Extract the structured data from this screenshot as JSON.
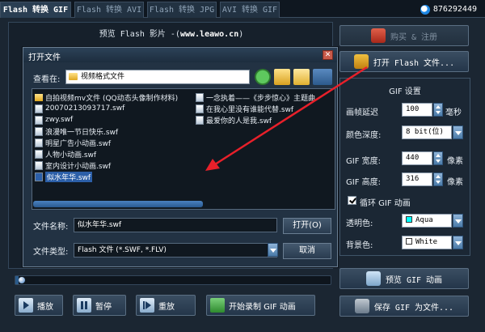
{
  "tabs": [
    {
      "label": "Flash 转换 GIF",
      "active": true
    },
    {
      "label": "Flash 转换 AVI",
      "active": false
    },
    {
      "label": "Flash 转换 JPG",
      "active": false
    },
    {
      "label": "AVI 转换 GIF",
      "active": false
    }
  ],
  "qq": "876292449",
  "preview": {
    "title_prefix": "预览 Flash 影片 -(",
    "site": "www.leawo.cn",
    "title_suffix": ")"
  },
  "right": {
    "buy_label": "购买 & 注册",
    "open_label": "打开 Flash 文件...",
    "settings_title": "GIF 设置",
    "frame_delay_label": "画帧延迟",
    "frame_delay_value": "100",
    "frame_delay_unit": "毫秒",
    "color_depth_label": "颜色深度:",
    "color_depth_value": "8 bit(位)",
    "width_label": "GIF 宽度:",
    "width_value": "440",
    "width_unit": "像素",
    "height_label": "GIF 高度:",
    "height_value": "316",
    "height_unit": "像素",
    "loop_label": "循环 GIF 动画",
    "loop_checked": true,
    "transparent_label": "透明色:",
    "transparent_value": "Aqua",
    "transparent_color": "#00ffff",
    "bg_label": "背景色:",
    "bg_value": "White",
    "bg_color": "#ffffff",
    "preview_gif_label": "预览 GIF 动画",
    "save_gif_label": "保存 GIF 为文件..."
  },
  "controls": {
    "play_label": "播放",
    "pause_label": "暂停",
    "replay_label": "重放",
    "record_label": "开始录制 GIF 动画",
    "progress": 0.01
  },
  "dialog": {
    "title": "打开文件",
    "look_in_label": "查看在:",
    "look_in_value": "视频格式文件",
    "files": [
      {
        "name": "自拍视频mv文件 (QQ动态头像制作材料)",
        "type": "folder"
      },
      {
        "name": "20070213093717.swf",
        "type": "swf"
      },
      {
        "name": "zwy.swf",
        "type": "swf"
      },
      {
        "name": "浪漫唯一节日快乐.swf",
        "type": "swf"
      },
      {
        "name": "明星广告小动画.swf",
        "type": "swf"
      },
      {
        "name": "人物小动画.swf",
        "type": "swf"
      },
      {
        "name": "室内设计小动画.swf",
        "type": "swf"
      },
      {
        "name": "似水年华.swf",
        "type": "swf",
        "selected": true
      },
      {
        "name": "一念执着——《步步惊心》主题曲",
        "type": "swf"
      },
      {
        "name": "在我心里没有谁能代替.swf",
        "type": "swf"
      },
      {
        "name": "最爱你的人是我.swf",
        "type": "swf"
      }
    ],
    "filename_label": "文件名称:",
    "filename_value": "似水年华.swf",
    "filetype_label": "文件类型:",
    "filetype_value": "Flash 文件 (*.SWF, *.FLV)",
    "open_button": "打开(O)",
    "cancel_button": "取消"
  },
  "colors": {
    "accent": "#2c5fa8",
    "arrow": "#e8202a"
  }
}
